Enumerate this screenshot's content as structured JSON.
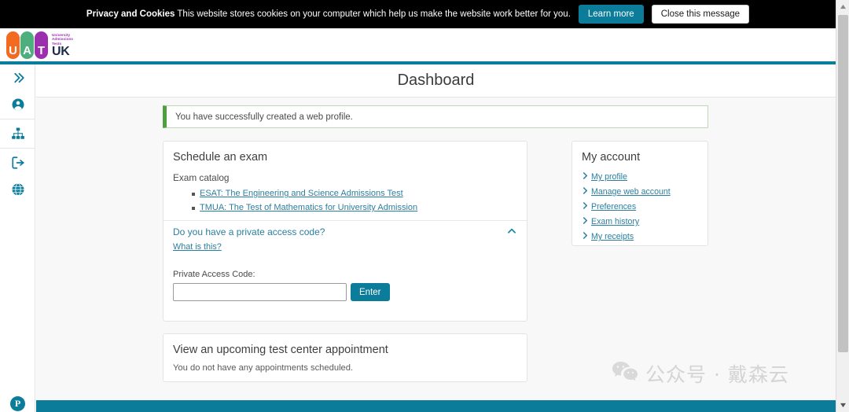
{
  "cookie_banner": {
    "bold_label": "Privacy and Cookies",
    "message": " This website stores cookies on your computer which help us make the website work better for you.",
    "learn_more_label": "Learn more",
    "close_label": "Close this message"
  },
  "logo": {
    "letters": [
      "U",
      "A",
      "T"
    ],
    "sub_line1": "University",
    "sub_line2": "Admissions",
    "sub_line3": "Tests",
    "word": "UK"
  },
  "sidebar": {
    "items": [
      {
        "icon": "chevron-double-right-icon",
        "name": "expand-menu"
      },
      {
        "icon": "user-circle-icon",
        "name": "my-account"
      },
      {
        "icon": "sitemap-icon",
        "name": "site-map"
      },
      {
        "icon": "sign-out-icon",
        "name": "sign-out"
      },
      {
        "icon": "globe-icon",
        "name": "language"
      }
    ],
    "footer_logo": "P"
  },
  "header": {
    "page_title": "Dashboard"
  },
  "alert": {
    "message": "You have successfully created a web profile."
  },
  "schedule_card": {
    "title": "Schedule an exam",
    "catalog_label": "Exam catalog",
    "exams": [
      "ESAT: The Engineering and Science Admissions Test",
      "TMUA: The Test of Mathematics for University Admission"
    ],
    "private_code_header": "Do you have a private access code?",
    "what_is_this": "What is this?",
    "code_label": "Private Access Code:",
    "code_value": "",
    "code_placeholder": "",
    "enter_label": "Enter"
  },
  "appointment_card": {
    "title": "View an upcoming test center appointment",
    "message": "You do not have any appointments scheduled."
  },
  "account_card": {
    "title": "My account",
    "links": [
      "My profile",
      "Manage web account",
      "Preferences",
      "Exam history",
      "My receipts"
    ]
  },
  "watermark": {
    "text": "公众号 · 戴森云"
  },
  "colors": {
    "brand_teal": "#0b7c99",
    "link_teal": "#2a7fa0",
    "success_green": "#4f9e3f",
    "logo_orange": "#f36a21",
    "logo_green": "#4caf7d",
    "logo_purple": "#9b2fae",
    "banner_black": "#000000"
  }
}
